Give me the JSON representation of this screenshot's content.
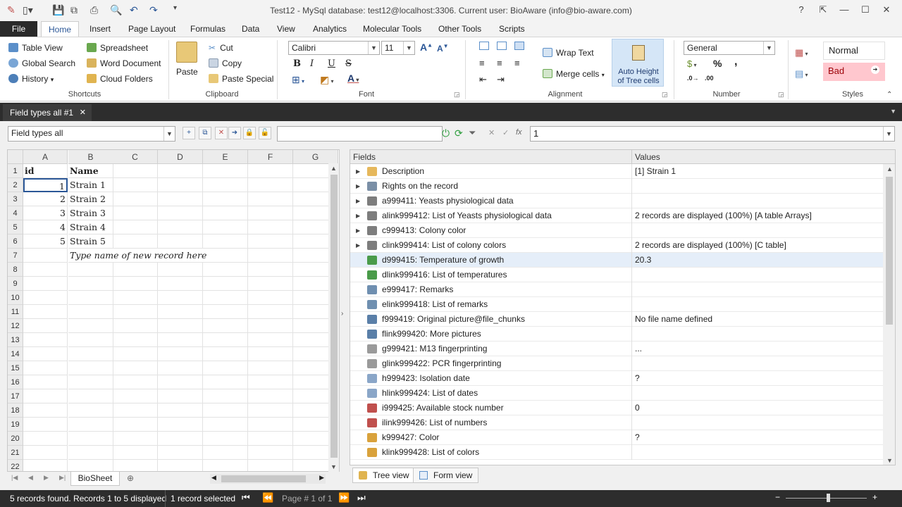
{
  "window": {
    "title": "Test12 - MySql database: test12@localhost:3306. Current user: BioAware (info@bio-aware.com)"
  },
  "menu": {
    "file": "File",
    "tabs": [
      "Home",
      "Insert",
      "Page Layout",
      "Formulas",
      "Data",
      "View",
      "Analytics",
      "Molecular Tools",
      "Other Tools",
      "Scripts"
    ]
  },
  "ribbon": {
    "shortcuts": {
      "table_view": "Table View",
      "global_search": "Global Search",
      "history": "History",
      "spreadsheet": "Spreadsheet",
      "word_document": "Word Document",
      "cloud_folders": "Cloud Folders",
      "label": "Shortcuts"
    },
    "clipboard": {
      "paste": "Paste",
      "cut": "Cut",
      "copy": "Copy",
      "paste_special": "Paste Special",
      "label": "Clipboard"
    },
    "font": {
      "family": "Calibri",
      "size": "11",
      "bold": "B",
      "italic": "I",
      "underline": "U",
      "strike": "S",
      "label": "Font"
    },
    "alignment": {
      "wrap_text": "Wrap Text",
      "merge_cells": "Merge cells",
      "auto_height_1": "Auto Height",
      "auto_height_2": "of Tree cells",
      "label": "Alignment"
    },
    "number": {
      "format": "General",
      "percent": "%",
      "comma": ",",
      "label": "Number"
    },
    "styles": {
      "normal": "Normal",
      "bad": "Bad",
      "label": "Styles"
    }
  },
  "doc_tab": {
    "label": "Field types all #1"
  },
  "toolbar": {
    "view_select": "Field types all",
    "formula_value": "1",
    "search_value": ""
  },
  "grid": {
    "columns": [
      "A",
      "B",
      "C",
      "D",
      "E",
      "F",
      "G"
    ],
    "rows": [
      "1",
      "2",
      "3",
      "4",
      "5",
      "6",
      "7",
      "8",
      "9",
      "10",
      "11",
      "12",
      "13",
      "14",
      "15",
      "16",
      "17",
      "18",
      "19",
      "20",
      "21",
      "22"
    ],
    "header": {
      "a": "id",
      "b": "Name"
    },
    "records": [
      {
        "id": "1",
        "name": "Strain 1"
      },
      {
        "id": "2",
        "name": "Strain 2"
      },
      {
        "id": "3",
        "name": "Strain 3"
      },
      {
        "id": "4",
        "name": "Strain 4"
      },
      {
        "id": "5",
        "name": "Strain 5"
      }
    ],
    "new_record_hint": "Type name of new record here",
    "sheet_tab": "BioSheet"
  },
  "fields_panel": {
    "header_fields": "Fields",
    "header_values": "Values",
    "rows": [
      {
        "name": "Description",
        "value": "[1] Strain 1",
        "expand": true,
        "icon_color": "#e6b85c"
      },
      {
        "name": "Rights on the record",
        "value": "",
        "expand": true,
        "icon_color": "#7a8fa6"
      },
      {
        "name": "a999411: Yeasts physiological data",
        "value": "",
        "expand": true,
        "icon_color": "#7d7d7d"
      },
      {
        "name": "alink999412: List of Yeasts physiological data",
        "value": "2 records are displayed (100%) [A table Arrays]",
        "expand": true,
        "icon_color": "#7d7d7d"
      },
      {
        "name": "c999413: Colony color",
        "value": "",
        "expand": true,
        "icon_color": "#7d7d7d"
      },
      {
        "name": "clink999414: List of colony colors",
        "value": "2 records are displayed (100%) [C table]",
        "expand": true,
        "icon_color": "#7d7d7d"
      },
      {
        "name": "d999415: Temperature of growth",
        "value": "20.3",
        "expand": false,
        "icon_color": "#4a9b4a"
      },
      {
        "name": "dlink999416: List of temperatures",
        "value": "",
        "expand": false,
        "icon_color": "#4a9b4a"
      },
      {
        "name": "e999417: Remarks",
        "value": "",
        "expand": false,
        "icon_color": "#6f8fb0"
      },
      {
        "name": "elink999418: List of remarks",
        "value": "",
        "expand": false,
        "icon_color": "#6f8fb0"
      },
      {
        "name": "f999419: Original picture@file_chunks",
        "value": "No file name defined",
        "expand": false,
        "icon_color": "#5a7fa8"
      },
      {
        "name": "flink999420: More pictures",
        "value": "",
        "expand": false,
        "icon_color": "#5a7fa8"
      },
      {
        "name": "g999421: M13 fingerprinting",
        "value": "...",
        "expand": false,
        "icon_color": "#9a9a9a"
      },
      {
        "name": "glink999422: PCR fingerprinting",
        "value": "",
        "expand": false,
        "icon_color": "#9a9a9a"
      },
      {
        "name": "h999423: Isolation date",
        "value": "?",
        "expand": false,
        "icon_color": "#8aa6c8"
      },
      {
        "name": "hlink999424: List of dates",
        "value": "",
        "expand": false,
        "icon_color": "#8aa6c8"
      },
      {
        "name": "i999425: Available stock number",
        "value": "0",
        "expand": false,
        "icon_color": "#c0504d"
      },
      {
        "name": "ilink999426: List of numbers",
        "value": "",
        "expand": false,
        "icon_color": "#c0504d"
      },
      {
        "name": "k999427: Color",
        "value": "?",
        "expand": false,
        "icon_color": "#d9a23c"
      },
      {
        "name": "klink999428: List of colors",
        "value": "",
        "expand": false,
        "icon_color": "#d9a23c"
      }
    ],
    "tabs": {
      "tree_view": "Tree view",
      "form_view": "Form view"
    }
  },
  "status": {
    "records_found": "5 records found. Records 1 to 5 displayed",
    "selected": "1 record selected",
    "page": "Page # 1 of 1"
  }
}
